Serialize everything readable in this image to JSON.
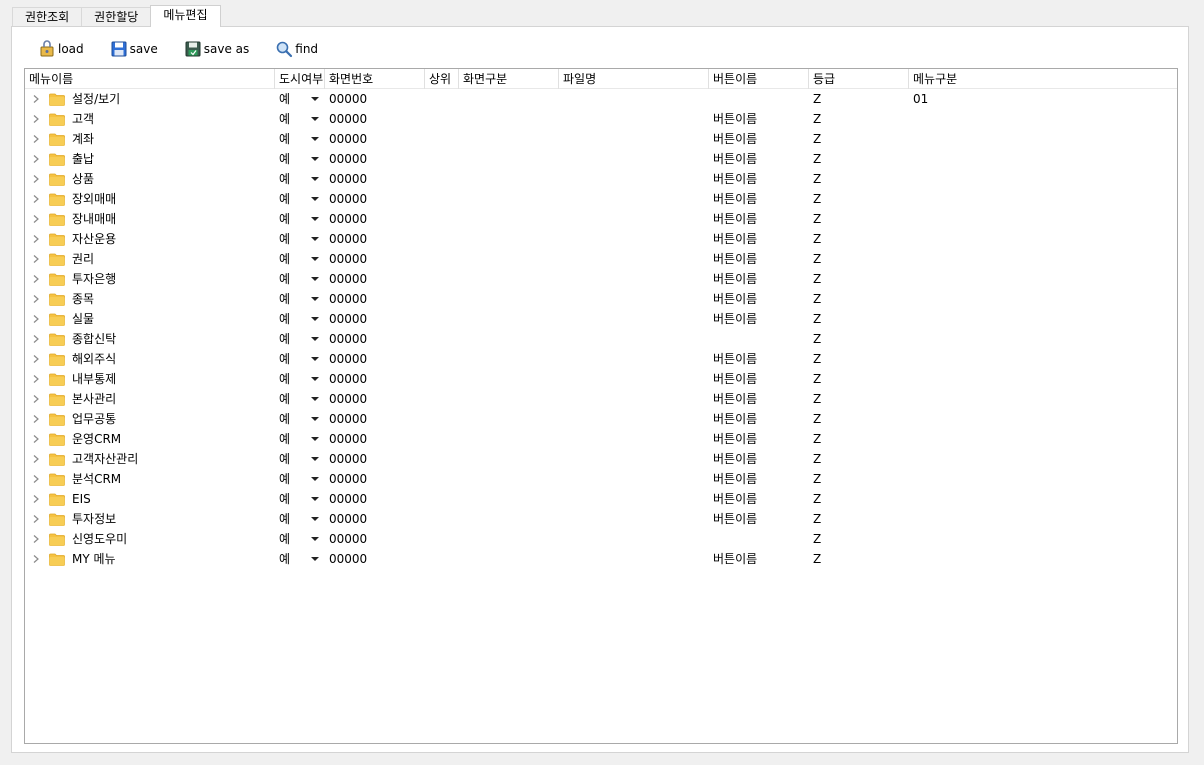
{
  "tabs": [
    {
      "label": "권한조회"
    },
    {
      "label": "권한할당"
    },
    {
      "label": "메뉴편집"
    }
  ],
  "toolbar": {
    "load": "load",
    "save": "save",
    "save_as": "save as",
    "find": "find"
  },
  "columns": [
    "메뉴이름",
    "도시여부",
    "화면번호",
    "상위",
    "화면구분",
    "파일명",
    "버튼이름",
    "등급",
    "메뉴구분"
  ],
  "rows": [
    {
      "name": "설정/보기",
      "display": "예",
      "screen": "00000",
      "button": "",
      "grade": "Z",
      "menu_type": "01"
    },
    {
      "name": "고객",
      "display": "예",
      "screen": "00000",
      "button": "버튼이름",
      "grade": "Z",
      "menu_type": ""
    },
    {
      "name": "계좌",
      "display": "예",
      "screen": "00000",
      "button": "버튼이름",
      "grade": "Z",
      "menu_type": ""
    },
    {
      "name": "출납",
      "display": "예",
      "screen": "00000",
      "button": "버튼이름",
      "grade": "Z",
      "menu_type": ""
    },
    {
      "name": "상품",
      "display": "예",
      "screen": "00000",
      "button": "버튼이름",
      "grade": "Z",
      "menu_type": ""
    },
    {
      "name": "장외매매",
      "display": "예",
      "screen": "00000",
      "button": "버튼이름",
      "grade": "Z",
      "menu_type": ""
    },
    {
      "name": "장내매매",
      "display": "예",
      "screen": "00000",
      "button": "버튼이름",
      "grade": "Z",
      "menu_type": ""
    },
    {
      "name": "자산운용",
      "display": "예",
      "screen": "00000",
      "button": "버튼이름",
      "grade": "Z",
      "menu_type": ""
    },
    {
      "name": "권리",
      "display": "예",
      "screen": "00000",
      "button": "버튼이름",
      "grade": "Z",
      "menu_type": ""
    },
    {
      "name": "투자은행",
      "display": "예",
      "screen": "00000",
      "button": "버튼이름",
      "grade": "Z",
      "menu_type": ""
    },
    {
      "name": "종목",
      "display": "예",
      "screen": "00000",
      "button": "버튼이름",
      "grade": "Z",
      "menu_type": ""
    },
    {
      "name": "실물",
      "display": "예",
      "screen": "00000",
      "button": "버튼이름",
      "grade": "Z",
      "menu_type": ""
    },
    {
      "name": "종합신탁",
      "display": "예",
      "screen": "00000",
      "button": "",
      "grade": "Z",
      "menu_type": ""
    },
    {
      "name": "해외주식",
      "display": "예",
      "screen": "00000",
      "button": "버튼이름",
      "grade": "Z",
      "menu_type": ""
    },
    {
      "name": "내부통제",
      "display": "예",
      "screen": "00000",
      "button": "버튼이름",
      "grade": "Z",
      "menu_type": ""
    },
    {
      "name": "본사관리",
      "display": "예",
      "screen": "00000",
      "button": "버튼이름",
      "grade": "Z",
      "menu_type": ""
    },
    {
      "name": "업무공통",
      "display": "예",
      "screen": "00000",
      "button": "버튼이름",
      "grade": "Z",
      "menu_type": ""
    },
    {
      "name": "운영CRM",
      "display": "예",
      "screen": "00000",
      "button": "버튼이름",
      "grade": "Z",
      "menu_type": ""
    },
    {
      "name": "고객자산관리",
      "display": "예",
      "screen": "00000",
      "button": "버튼이름",
      "grade": "Z",
      "menu_type": ""
    },
    {
      "name": "분석CRM",
      "display": "예",
      "screen": "00000",
      "button": "버튼이름",
      "grade": "Z",
      "menu_type": ""
    },
    {
      "name": "EIS",
      "display": "예",
      "screen": "00000",
      "button": "버튼이름",
      "grade": "Z",
      "menu_type": ""
    },
    {
      "name": "투자정보",
      "display": "예",
      "screen": "00000",
      "button": "버튼이름",
      "grade": "Z",
      "menu_type": ""
    },
    {
      "name": "신영도우미",
      "display": "예",
      "screen": "00000",
      "button": "",
      "grade": "Z",
      "menu_type": ""
    },
    {
      "name": "MY 메뉴",
      "display": "예",
      "screen": "00000",
      "button": "버튼이름",
      "grade": "Z",
      "menu_type": ""
    }
  ],
  "colors": {
    "folder": "#f5c242",
    "folder_dark": "#e0a826",
    "grid_border": "#a9a9a9"
  },
  "icons": {
    "load": "load-icon",
    "save": "floppy-disk-icon",
    "save_as": "save-as-icon",
    "find": "magnifier-icon"
  }
}
